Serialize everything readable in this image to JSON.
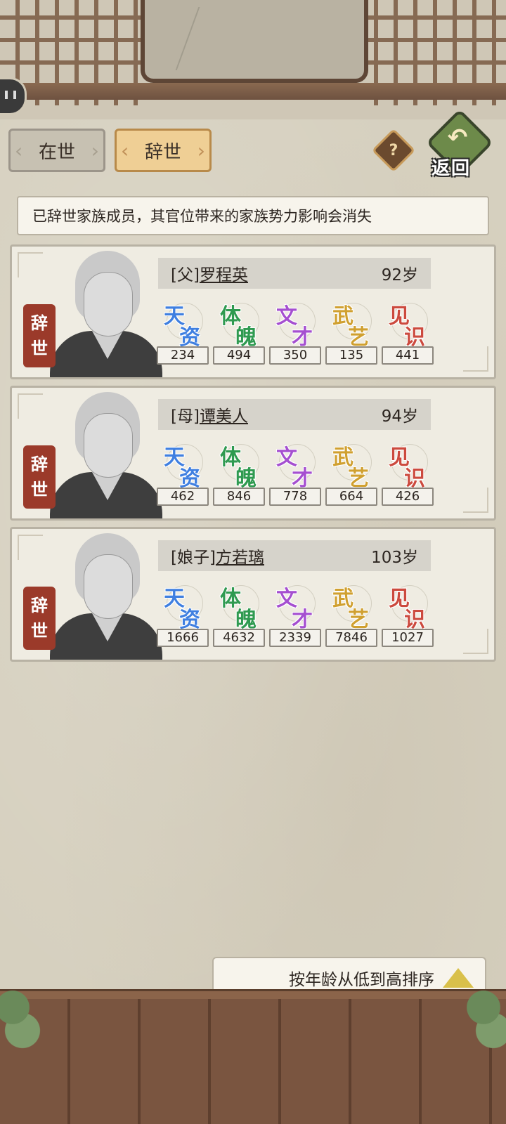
{
  "tabs": [
    {
      "label": "在世",
      "active": false
    },
    {
      "label": "辞世",
      "active": true
    }
  ],
  "help_label": "?",
  "back_label": "返回",
  "notice": "已辞世家族成员，其官位带来的家族势力影响会消失",
  "stat_labels": [
    {
      "c1": "天",
      "c2": "资",
      "color": "#3f7fe0"
    },
    {
      "c1": "体",
      "c2": "魄",
      "color": "#2f9a50"
    },
    {
      "c1": "文",
      "c2": "才",
      "color": "#a54fd0"
    },
    {
      "c1": "武",
      "c2": "艺",
      "color": "#d0a030"
    },
    {
      "c1": "见",
      "c2": "识",
      "color": "#cc4a3e"
    }
  ],
  "members": [
    {
      "relation": "[父]",
      "name": "罗程英",
      "age": "92岁",
      "tag": [
        "辞",
        "世"
      ],
      "stats": [
        "234",
        "494",
        "350",
        "135",
        "441"
      ]
    },
    {
      "relation": "[母]",
      "name": "谭美人",
      "age": "94岁",
      "tag": [
        "辞",
        "世"
      ],
      "stats": [
        "462",
        "846",
        "778",
        "664",
        "426"
      ]
    },
    {
      "relation": "[娘子]",
      "name": "方若璃",
      "age": "103岁",
      "tag": [
        "辞",
        "世"
      ],
      "stats": [
        "1666",
        "4632",
        "2339",
        "7846",
        "1027"
      ]
    }
  ],
  "sort_label": "按年龄从低到高排序"
}
